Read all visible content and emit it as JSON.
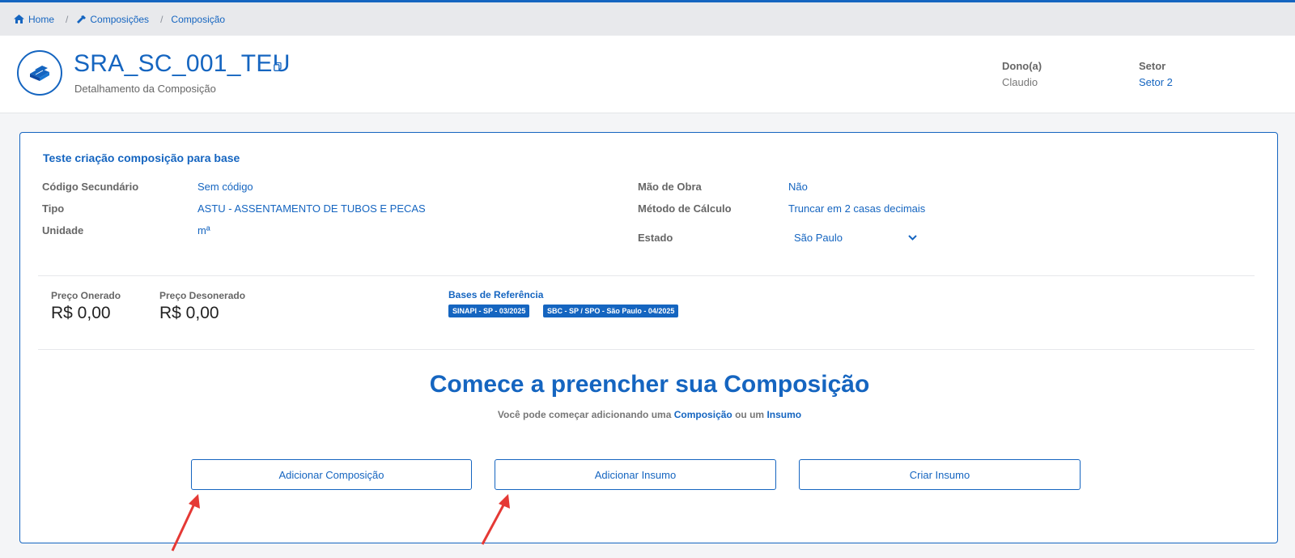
{
  "breadcrumb": {
    "home": "Home",
    "separator": "/",
    "compositions": "Composições",
    "composition": "Composição"
  },
  "header": {
    "title": "SRA_SC_001_TEU",
    "subtitle": "Detalhamento da Composição",
    "owner_label": "Dono(a)",
    "owner_value": "Claudio",
    "sector_label": "Setor",
    "sector_value": "Setor 2"
  },
  "details": {
    "name": "Teste criação composição para base",
    "secondary_code_label": "Código Secundário",
    "secondary_code_value": "Sem código",
    "type_label": "Tipo",
    "type_value": "ASTU - ASSENTAMENTO DE TUBOS E PECAS",
    "unit_label": "Unidade",
    "unit_value": "mª",
    "labor_label": "Mão de Obra",
    "labor_value": "Não",
    "calc_label": "Método de Cálculo",
    "calc_value": "Truncar em 2 casas decimais",
    "state_label": "Estado",
    "state_value": "São Paulo"
  },
  "prices": {
    "onerado_label": "Preço Onerado",
    "onerado_value": "R$ 0,00",
    "desonerado_label": "Preço Desonerado",
    "desonerado_value": "R$ 0,00",
    "bases_label": "Bases de Referência",
    "bases": [
      "SINAPI - SP - 03/2025",
      "SBC - SP / SPO - São Paulo - 04/2025"
    ]
  },
  "empty_state": {
    "title": "Comece a preencher sua Composição",
    "sub_prefix": "Você pode começar adicionando uma",
    "sub_composition": "Composição",
    "sub_middle": "ou um",
    "sub_insumo": "Insumo"
  },
  "actions": {
    "add_composition": "Adicionar Composição",
    "add_insumo": "Adicionar Insumo",
    "create_insumo": "Criar Insumo"
  },
  "colors": {
    "accent": "#1565c0",
    "annotation_arrow": "#e53935"
  },
  "icons": [
    "home-icon",
    "hammer-icon",
    "brick-icon",
    "copy-icon",
    "chevron-down-icon"
  ]
}
